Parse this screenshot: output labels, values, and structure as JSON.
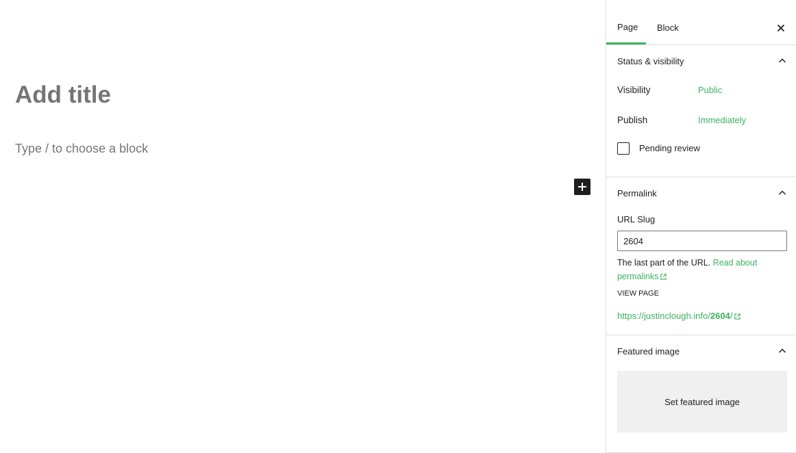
{
  "editor": {
    "title_placeholder": "Add title",
    "block_placeholder": "Type / to choose a block",
    "add_block_icon": "plus-icon"
  },
  "sidebar": {
    "tabs": [
      {
        "label": "Page",
        "active": true
      },
      {
        "label": "Block",
        "active": false
      }
    ],
    "close_icon": "close-icon",
    "status_visibility": {
      "title": "Status & visibility",
      "visibility_label": "Visibility",
      "visibility_value": "Public",
      "publish_label": "Publish",
      "publish_value": "Immediately",
      "pending_review_label": "Pending review",
      "pending_review_checked": false
    },
    "permalink": {
      "title": "Permalink",
      "url_slug_label": "URL Slug",
      "url_slug_value": "2604",
      "help_text": "The last part of the URL.",
      "help_link_line1": "Read about",
      "help_link_line2": "permalinks",
      "view_page_label": "VIEW PAGE",
      "url_prefix": "https://justinclough.info/",
      "url_slug_bold": "2604",
      "url_suffix": "/"
    },
    "featured_image": {
      "title": "Featured image",
      "button_label": "Set featured image"
    }
  },
  "colors": {
    "accent": "#3db25e",
    "text": "#1e1e1e",
    "muted": "#757575"
  }
}
